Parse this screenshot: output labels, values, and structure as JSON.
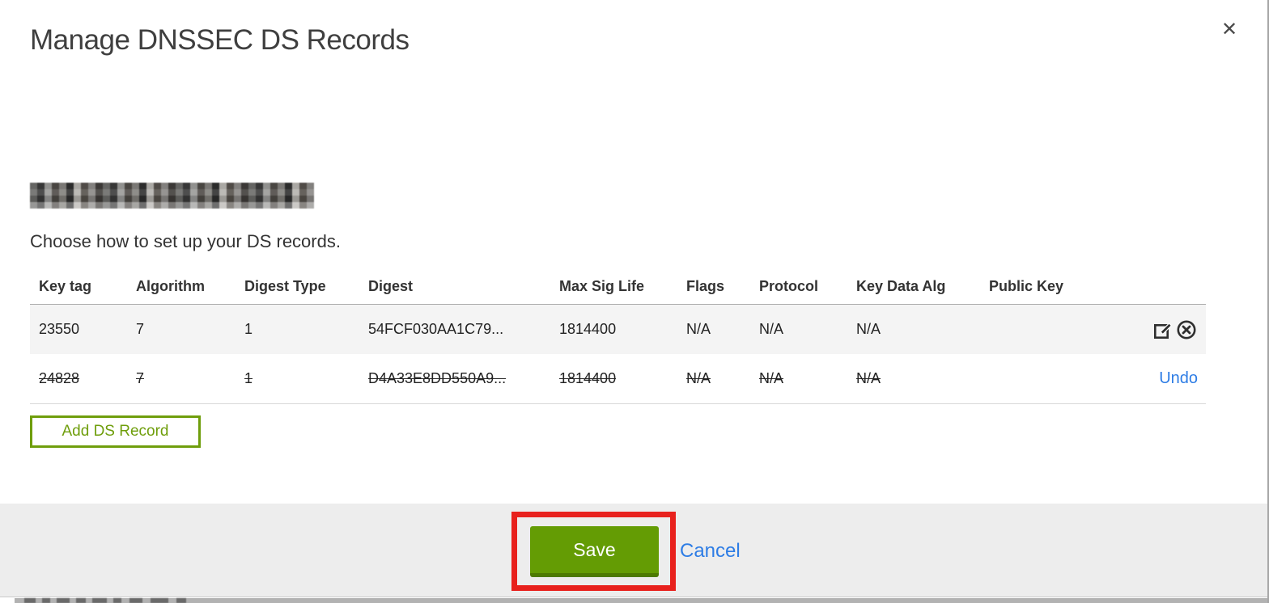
{
  "dialog": {
    "title": "Manage DNSSEC DS Records",
    "close_glyph": "✕"
  },
  "intro": {
    "instruction": "Choose how to set up your DS records."
  },
  "table": {
    "headers": [
      "Key tag",
      "Algorithm",
      "Digest Type",
      "Digest",
      "Max Sig Life",
      "Flags",
      "Protocol",
      "Key Data Alg",
      "Public Key"
    ],
    "rows": [
      {
        "key_tag": "23550",
        "algorithm": "7",
        "digest_type": "1",
        "digest": "54FCF030AA1C79...",
        "max_sig_life": "1814400",
        "flags": "N/A",
        "protocol": "N/A",
        "key_data_alg": "N/A",
        "public_key": "",
        "state": "active"
      },
      {
        "key_tag": "24828",
        "algorithm": "7",
        "digest_type": "1",
        "digest": "D4A33E8DD550A9...",
        "max_sig_life": "1814400",
        "flags": "N/A",
        "protocol": "N/A",
        "key_data_alg": "N/A",
        "public_key": "",
        "state": "marked-for-deletion",
        "undo_label": "Undo"
      }
    ]
  },
  "actions": {
    "add_ds_record": "Add DS Record",
    "save": "Save",
    "cancel": "Cancel"
  },
  "colors": {
    "button_green": "#649c04",
    "outline_green": "#6f9e0c",
    "link_blue": "#2e7de5",
    "annotation_red": "#e8211d",
    "row_highlight": "#f4f4f4"
  }
}
